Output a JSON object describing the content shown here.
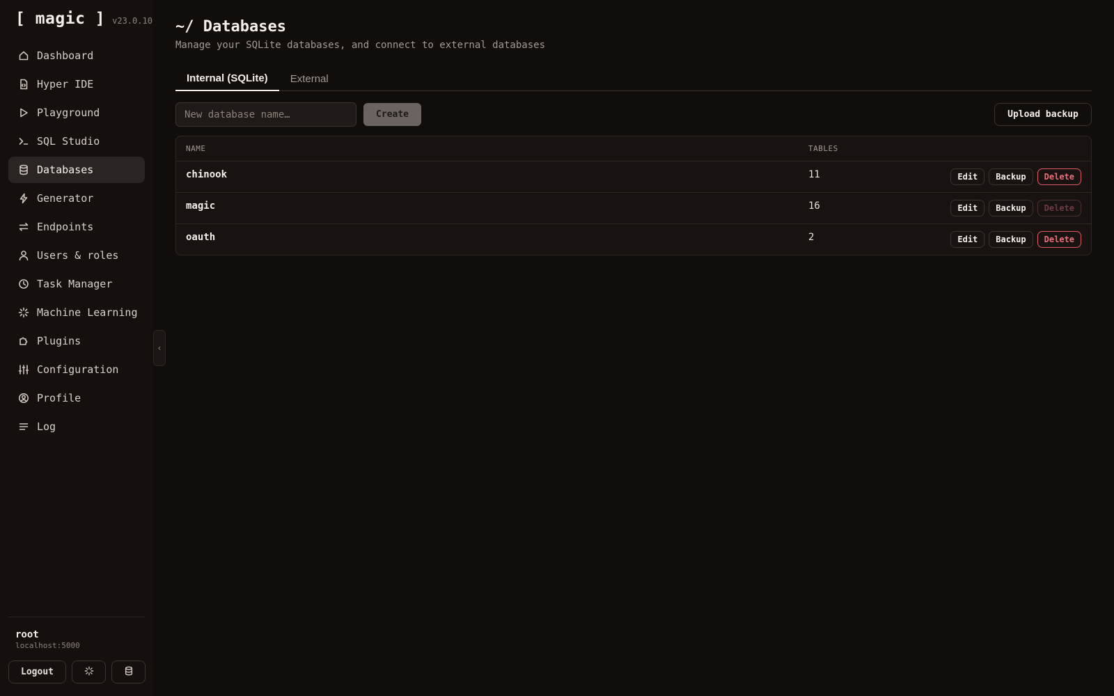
{
  "app": {
    "name": "[ magic ]",
    "version": "v23.0.10"
  },
  "sidebar": {
    "items": [
      {
        "label": "Dashboard",
        "icon": "home-icon",
        "active": false
      },
      {
        "label": "Hyper IDE",
        "icon": "file-code-icon",
        "active": false
      },
      {
        "label": "Playground",
        "icon": "play-icon",
        "active": false
      },
      {
        "label": "SQL Studio",
        "icon": "terminal-icon",
        "active": false
      },
      {
        "label": "Databases",
        "icon": "database-icon",
        "active": true
      },
      {
        "label": "Generator",
        "icon": "lightning-icon",
        "active": false
      },
      {
        "label": "Endpoints",
        "icon": "arrows-exchange-icon",
        "active": false
      },
      {
        "label": "Users & roles",
        "icon": "user-icon",
        "active": false
      },
      {
        "label": "Task Manager",
        "icon": "clock-icon",
        "active": false
      },
      {
        "label": "Machine Learning",
        "icon": "sparkle-icon",
        "active": false
      },
      {
        "label": "Plugins",
        "icon": "puzzle-icon",
        "active": false
      },
      {
        "label": "Configuration",
        "icon": "sliders-icon",
        "active": false
      },
      {
        "label": "Profile",
        "icon": "user-circle-icon",
        "active": false
      },
      {
        "label": "Log",
        "icon": "lines-icon",
        "active": false
      }
    ],
    "user": {
      "name": "root",
      "host": "localhost:5000"
    },
    "logout_label": "Logout"
  },
  "page": {
    "title": "~/ Databases",
    "subtitle": "Manage your SQLite databases, and connect to external databases"
  },
  "tabs": [
    {
      "label": "Internal (SQLite)",
      "active": true
    },
    {
      "label": "External",
      "active": false
    }
  ],
  "toolbar": {
    "new_db_placeholder": "New database name…",
    "create_label": "Create",
    "upload_label": "Upload backup"
  },
  "table": {
    "headers": {
      "name": "NAME",
      "tables": "TABLES"
    },
    "rows": [
      {
        "name": "chinook",
        "tables": "11",
        "delete_enabled": true
      },
      {
        "name": "magic",
        "tables": "16",
        "delete_enabled": false
      },
      {
        "name": "oauth",
        "tables": "2",
        "delete_enabled": true
      }
    ],
    "actions": {
      "edit": "Edit",
      "backup": "Backup",
      "delete": "Delete"
    }
  },
  "colors": {
    "background": "#110d0b",
    "sidebar": "#150f0d",
    "danger": "#ee6e78",
    "active_nav": "#2a2422"
  }
}
